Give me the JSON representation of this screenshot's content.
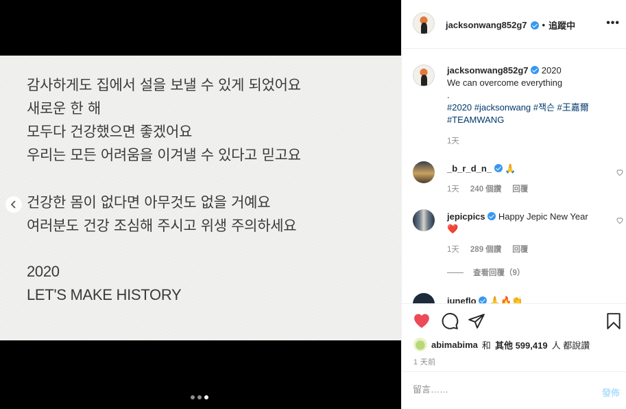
{
  "image_text": {
    "lines": [
      "감사하게도 집에서 설을 보낼 수 있게 되었어요",
      "새로운 한 해",
      "모두다 건강했으면 좋겠어요",
      "우리는 모든 어려움을 이겨낼 수 있다고 믿고요",
      "건강한 몸이 없다면 아무것도 없을 거예요",
      "여러분도 건강 조심해 주시고 위생 주의하세요",
      "2020",
      "LET'S MAKE HISTORY"
    ]
  },
  "carousel": {
    "count": 3,
    "active_index": 2
  },
  "header": {
    "username": "jacksonwang852g7",
    "separator": "•",
    "follow_label": "追蹤中",
    "more_label": "•••"
  },
  "caption": {
    "username": "jacksonwang852g7",
    "line1": "2020",
    "line2": "We can overcome everything",
    "line3": ".",
    "hashtags_line1": "#2020 #jacksonwang #잭슨 #王嘉爾",
    "hashtags_line2": "#TEAMWANG",
    "time": "1天"
  },
  "comments": [
    {
      "username": "_b_r_d_n_",
      "text": "🙏",
      "time": "1天",
      "likes": "240 個讚",
      "reply": "回覆"
    },
    {
      "username": "jepicpics",
      "text": "Happy Jepic New Year",
      "emoji": "❤️",
      "time": "1天",
      "likes": "289 個讚",
      "reply": "回覆",
      "view_replies": "查看回覆（9）"
    },
    {
      "username": "juneflo",
      "text": "🙏🔥👏"
    }
  ],
  "likes": {
    "user": "abimabima",
    "connector": "和",
    "others_label": "其他",
    "count": "599,419",
    "suffix": "人 都說讚"
  },
  "post_time": "1 天前",
  "composer": {
    "placeholder": "留言……",
    "post_label": "發佈"
  },
  "colors": {
    "like_red": "#ed4956",
    "link_blue": "#00376b",
    "verified_blue": "#3897f0",
    "post_disabled": "#b2dffc"
  }
}
